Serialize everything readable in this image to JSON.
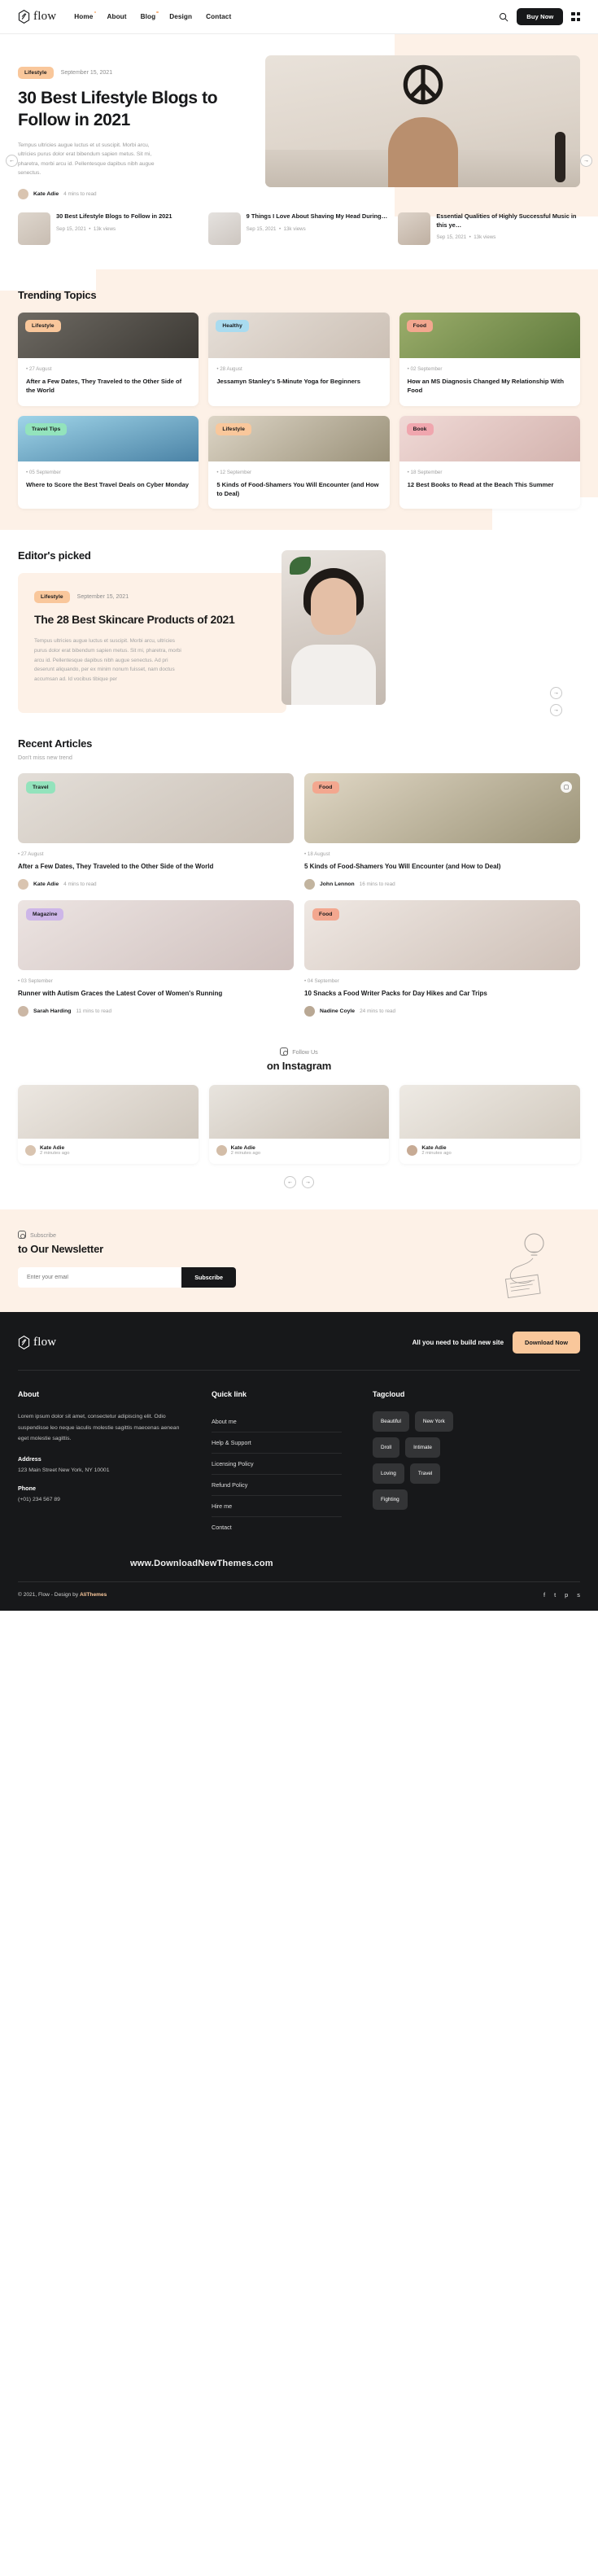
{
  "brand": {
    "name": "flow",
    "logo_icon": "flow-hex-icon"
  },
  "header": {
    "nav": [
      {
        "label": "Home",
        "dot": true
      },
      {
        "label": "About",
        "dot": false
      },
      {
        "label": "Blog",
        "dot": true
      },
      {
        "label": "Design",
        "dot": false
      },
      {
        "label": "Contact",
        "dot": false
      }
    ],
    "search_icon": "search-icon",
    "buy_now": "Buy Now",
    "grid_icon": "grid-menu-icon"
  },
  "hero": {
    "category": "Lifestyle",
    "date": "September 15, 2021",
    "title": "30 Best Lifestyle Blogs to Follow in 2021",
    "excerpt": "Tempus ultricies augue luctus et ut suscipit. Morbi arcu, ultricies purus dolor erat bibendum sapien metus. Sit mi, pharetra, morbi arcu id. Pellentesque dapibus nibh augue senectus.",
    "author": "Kate Adie",
    "read_time": "4 mins to read",
    "prev_icon": "arrow-left-icon",
    "next_icon": "arrow-right-icon",
    "thumbs": [
      {
        "title": "30 Best Lifestyle Blogs to Follow in 2021",
        "date": "Sep 15, 2021",
        "views": "13k views"
      },
      {
        "title": "9 Things I Love About Shaving My Head During…",
        "date": "Sep 15, 2021",
        "views": "13k views"
      },
      {
        "title": "Essential Qualities of Highly Successful Music in this ye…",
        "date": "Sep 15, 2021",
        "views": "13k views"
      }
    ]
  },
  "trending": {
    "heading": "Trending Topics",
    "cards": [
      {
        "category": "Lifestyle",
        "cat_class": "",
        "img_class": "i-living",
        "date": "27 August",
        "title": "After a Few Dates, They Traveled to the Other Side of the World"
      },
      {
        "category": "Healthy",
        "cat_class": "healthy",
        "img_class": "i-hands",
        "date": "28 August",
        "title": "Jessamyn Stanley's 5-Minute Yoga for Beginners"
      },
      {
        "category": "Food",
        "cat_class": "food",
        "img_class": "i-salad",
        "date": "02 September",
        "title": "How an MS Diagnosis Changed My Relationship With Food"
      },
      {
        "category": "Travel Tips",
        "cat_class": "travel",
        "img_class": "i-sail",
        "date": "05 September",
        "title": "Where to Score the Best Travel Deals on Cyber Monday"
      },
      {
        "category": "Lifestyle",
        "cat_class": "",
        "img_class": "i-pasta",
        "date": "12 September",
        "title": "5 Kinds of Food-Shamers You Will Encounter (and How to Deal)"
      },
      {
        "category": "Book",
        "cat_class": "book",
        "img_class": "i-book",
        "date": "18 September",
        "title": "12 Best Books to Read at the Beach This Summer"
      }
    ]
  },
  "editor": {
    "heading": "Editor's picked",
    "category": "Lifestyle",
    "date": "September 15, 2021",
    "title": "The 28 Best Skincare Products of 2021",
    "excerpt": "Tempus ultricies augue luctus et suscipit. Morbi arcu, ultricies purus dolor erat bibendum sapien metus. Sit mi, pharetra, morbi arcu id. Pellentesque dapibus nibh augue senectus. Ad pri deserunt aliquando, per ex minim nonum fuisset, nam doctus accumsan ad. Id vocibus tibique per",
    "prev_icon": "arrow-right-icon",
    "next_icon": "arrow-down-icon"
  },
  "recent": {
    "heading": "Recent Articles",
    "subheading": "Don't miss new trend",
    "bookmark_icon": "bookmark-icon",
    "cards": [
      {
        "category": "Travel",
        "cat_class": "travel",
        "img_class": "r-i1",
        "date": "27 August",
        "title": "After a Few Dates, They Traveled to the Other Side of the World",
        "author": "Kate Adie",
        "read_time": "4 mins to read",
        "av": ""
      },
      {
        "category": "Food",
        "cat_class": "food",
        "img_class": "r-i2",
        "date": "18 August",
        "title": "5 Kinds of Food-Shamers You Will Encounter (and How to Deal)",
        "author": "John Lennon",
        "read_time": "16 mins to read",
        "av": "b"
      },
      {
        "category": "Magazine",
        "cat_class": "mag",
        "img_class": "r-i3",
        "date": "03 September",
        "title": "Runner with Autism Graces the Latest Cover of Women's Running",
        "author": "Sarah Harding",
        "read_time": "11 mins to read",
        "av": "c"
      },
      {
        "category": "Food",
        "cat_class": "food",
        "img_class": "r-i4",
        "date": "04 September",
        "title": "10 Snacks a Food Writer Packs for Day Hikes and Car Trips",
        "author": "Nadine Coyle",
        "read_time": "24 mins to read",
        "av": "d"
      }
    ]
  },
  "instagram": {
    "follow_label": "Follow Us",
    "heading": "on Instagram",
    "icon": "instagram-icon",
    "cards": [
      {
        "img_class": "ig1",
        "name": "Kate Adie",
        "time": "2 minutes ago",
        "av": ""
      },
      {
        "img_class": "ig2",
        "name": "Kate Adie",
        "time": "2 minutes ago",
        "av": "e"
      },
      {
        "img_class": "ig3",
        "name": "Kate Adie",
        "time": "2 minutes ago",
        "av": "f"
      }
    ],
    "prev_icon": "arrow-left-icon",
    "next_icon": "arrow-right-icon"
  },
  "newsletter": {
    "eyebrow": "Subscribe",
    "heading": "to Our Newsletter",
    "placeholder": "Enter your email",
    "value": "",
    "button": "Subscribe",
    "icon": "lightbulb-doodle-icon"
  },
  "footer": {
    "cta_text": "All you need to build new site",
    "cta_button": "Download Now",
    "about": {
      "heading": "About",
      "text": "Lorem ipsum dolor sit amet, consectetur adipiscing elit. Odio suspendisse leo neque iaculis molestie sagittis maecenas aenean eget molestie sagittis.",
      "address_label": "Address",
      "address": "123 Main Street New York, NY 10001",
      "phone_label": "Phone",
      "phone": "(+01) 234 567 89"
    },
    "quick": {
      "heading": "Quick link",
      "links": [
        "About me",
        "Help & Support",
        "Licensing Policy",
        "Refund Policy",
        "Hire me",
        "Contact"
      ]
    },
    "tagcloud": {
      "heading": "Tagcloud",
      "tags": [
        "Beautiful",
        "New York",
        "Droll",
        "Intimate",
        "Loving",
        "Travel",
        "Fighting"
      ]
    },
    "www": "www.DownloadNewThemes.com",
    "copyright_pre": "© 2021, Flow - Design by ",
    "copyright_brand": "AliThemes",
    "socials": [
      "f",
      "t",
      "p",
      "s"
    ]
  },
  "colors": {
    "cream": "#fdf1e7",
    "peach": "#f9c79b",
    "dark": "#17181a"
  }
}
